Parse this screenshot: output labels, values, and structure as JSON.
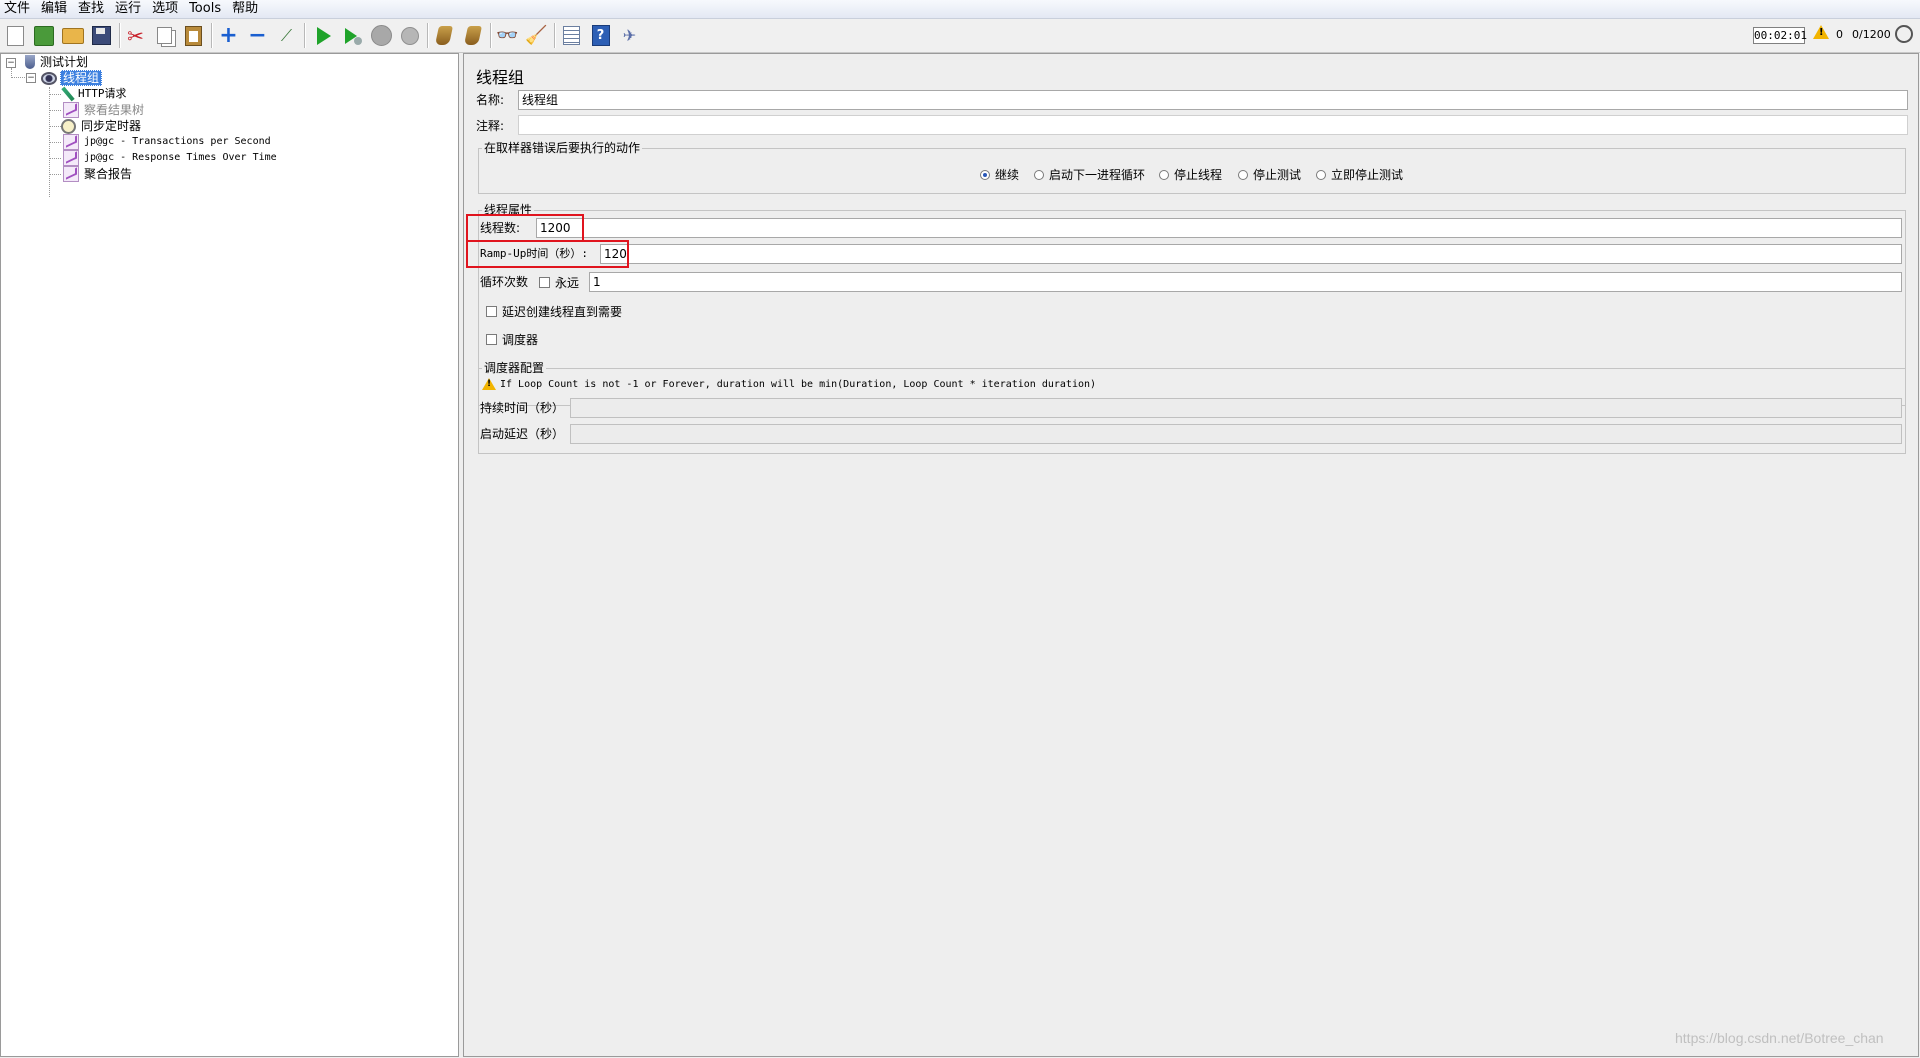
{
  "menu": [
    "文件",
    "编辑",
    "查找",
    "运行",
    "选项",
    "Tools",
    "帮助"
  ],
  "status": {
    "timer": "00:02:01",
    "warning_count": "0",
    "threads": "0/1200"
  },
  "tree": {
    "root": "测试计划",
    "thread_group": "线程组",
    "children": [
      "HTTP请求",
      "察看结果树",
      "同步定时器",
      "jp@gc - Transactions per Second",
      "jp@gc - Response Times Over Time",
      "聚合报告"
    ]
  },
  "panel": {
    "title": "线程组",
    "name_label": "名称:",
    "name_value": "线程组",
    "comment_label": "注释:",
    "comment_value": "",
    "error_action": {
      "title": "在取样器错误后要执行的动作",
      "options": [
        "继续",
        "启动下一进程循环",
        "停止线程",
        "停止测试",
        "立即停止测试"
      ],
      "selected": "继续"
    },
    "thread_props": {
      "title": "线程属性",
      "threads_label": "线程数:",
      "threads_value": "1200",
      "rampup_label": "Ramp-Up时间（秒）:",
      "rampup_value": "120",
      "loop_label": "循环次数",
      "forever_label": "永远",
      "loop_value": "1",
      "delay_label": "延迟创建线程直到需要",
      "scheduler_label": "调度器"
    },
    "scheduler": {
      "title": "调度器配置",
      "warning": "If Loop Count is not -1 or Forever, duration will be min(Duration, Loop Count * iteration duration)",
      "duration_label": "持续时间（秒）",
      "delay_label": "启动延迟（秒）"
    }
  },
  "watermark": "https://blog.csdn.net/Botree_chan"
}
